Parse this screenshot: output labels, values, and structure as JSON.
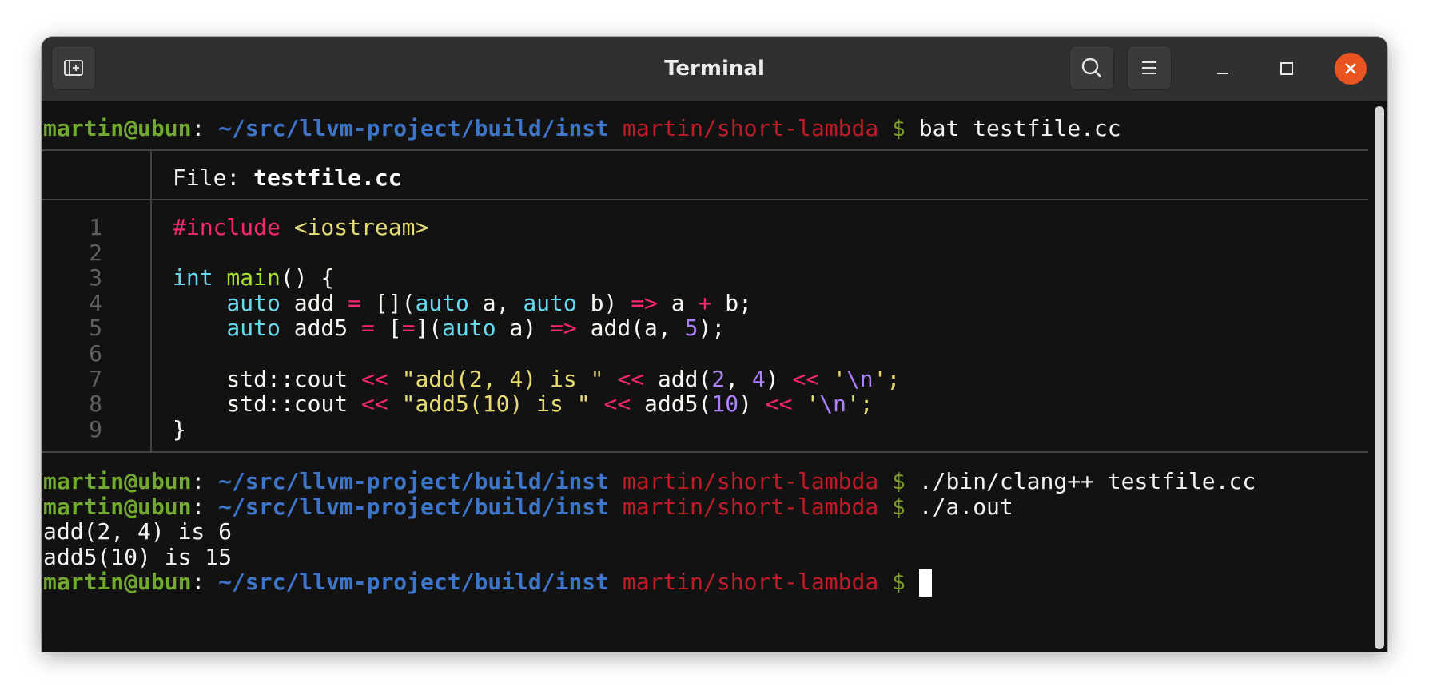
{
  "window": {
    "title": "Terminal",
    "close_color": "#e95420"
  },
  "prompt": {
    "user": "martin@ubun",
    "sep": ":",
    "path": "~/src/llvm-project/build/inst",
    "branch": "martin/short-lambda",
    "dollar": "$"
  },
  "commands": {
    "cmd1": "bat testfile.cc",
    "cmd2": "./bin/clang++ testfile.cc",
    "cmd3": "./a.out"
  },
  "file_header": {
    "label": "File: ",
    "name": "testfile.cc"
  },
  "line_numbers": [
    "1",
    "2",
    "3",
    "4",
    "5",
    "6",
    "7",
    "8",
    "9"
  ],
  "code": {
    "l1_a": "#include",
    "l1_b": " <iostream>",
    "l3_a": "int",
    "l3_b": " main",
    "l3_c": "() {",
    "l4_a": "    auto",
    "l4_b": " add ",
    "l4_c": "=",
    "l4_d": " [](",
    "l4_e": "auto",
    "l4_f": " a, ",
    "l4_g": "auto",
    "l4_h": " b) ",
    "l4_i": "=>",
    "l4_j": " a ",
    "l4_k": "+",
    "l4_l": " b;",
    "l5_a": "    auto",
    "l5_b": " add5 ",
    "l5_c": "=",
    "l5_d": " [",
    "l5_e": "=",
    "l5_f": "](",
    "l5_g": "auto",
    "l5_h": " a) ",
    "l5_i": "=>",
    "l5_j": " add(a, ",
    "l5_k": "5",
    "l5_l": ");",
    "l7_a": "    std::cout ",
    "l7_b": "<<",
    "l7_c": " \"add(2, 4) is \"",
    "l7_d": " ",
    "l7_e": "<<",
    "l7_f": " add(",
    "l7_g": "2",
    "l7_h": ", ",
    "l7_i": "4",
    "l7_j": ") ",
    "l7_k": "<<",
    "l7_l": " '",
    "l7_m": "\\n",
    "l7_n": "';",
    "l8_a": "    std::cout ",
    "l8_b": "<<",
    "l8_c": " \"add5(10) is \"",
    "l8_d": " ",
    "l8_e": "<<",
    "l8_f": " add5(",
    "l8_g": "10",
    "l8_h": ") ",
    "l8_i": "<<",
    "l8_j": " '",
    "l8_k": "\\n",
    "l8_l": "';",
    "l9": "}"
  },
  "output": {
    "o1": "add(2, 4) is 6",
    "o2": "add5(10) is 15"
  }
}
